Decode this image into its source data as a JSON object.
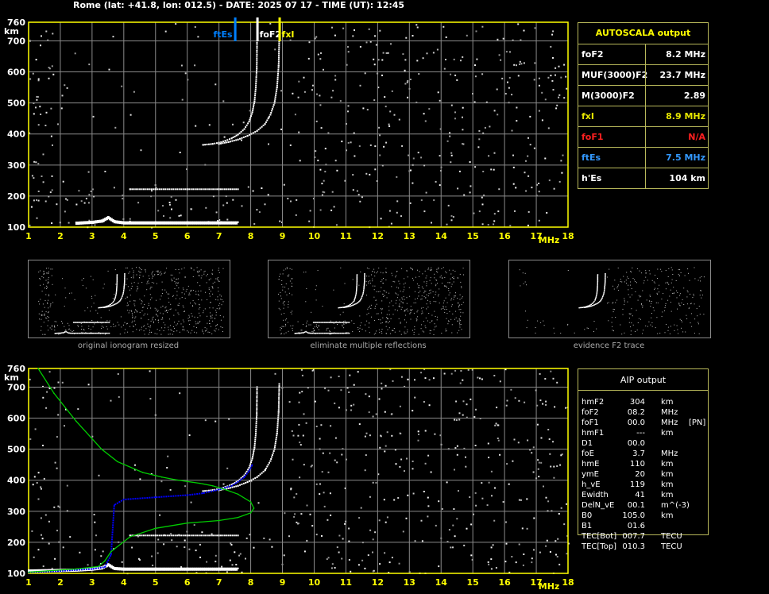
{
  "header": "Rome (lat: +41.8, lon: 012.5) - DATE: 2025 07 17 - TIME (UT): 12:45",
  "colors": {
    "axis": "#ffff00",
    "grid": "#8a8a8a",
    "trace": "#ffffff",
    "fxl": "#ffff00",
    "ftes": "#0080ff",
    "blue_profile": "#0000ff",
    "green_profile": "#00cc00",
    "fof1": "#ff2020"
  },
  "chart_data": [
    {
      "type": "scatter",
      "title": "",
      "xlabel": "MHz",
      "ylabel": "km",
      "xlim": [
        1,
        18
      ],
      "ylim": [
        100,
        760
      ],
      "x_ticks": [
        "1",
        "2",
        "3",
        "4",
        "5",
        "6",
        "7",
        "8",
        "9",
        "10",
        "11",
        "12",
        "13",
        "14",
        "15",
        "16",
        "17",
        "18"
      ],
      "y_ticks": [
        "100",
        "200",
        "300",
        "400",
        "500",
        "600",
        "700",
        "760"
      ],
      "grid": true,
      "markers": [
        {
          "label": "ftEs",
          "x": 7.5,
          "color": "#0080ff"
        },
        {
          "label": "foF2",
          "x": 8.2,
          "color": "#ffffff"
        },
        {
          "label": "fxI",
          "x": 8.9,
          "color": "#ffff00"
        }
      ],
      "series": [
        {
          "trace": "o",
          "x": [
            6.5,
            6.8,
            7.0,
            7.2,
            7.4,
            7.6,
            7.8,
            7.95,
            8.05,
            8.12,
            8.16,
            8.19,
            8.2
          ],
          "y": [
            365,
            368,
            372,
            378,
            386,
            398,
            416,
            440,
            470,
            505,
            550,
            610,
            700
          ]
        },
        {
          "trace": "x",
          "x": [
            7.0,
            7.3,
            7.6,
            7.9,
            8.2,
            8.45,
            8.62,
            8.75,
            8.83,
            8.88,
            8.9
          ],
          "y": [
            368,
            374,
            382,
            394,
            410,
            432,
            462,
            500,
            550,
            620,
            710
          ]
        },
        {
          "trace": "Es",
          "x": [
            2.5,
            3.0,
            3.3,
            3.5,
            3.7,
            4.0,
            5.0,
            6.0,
            7.0,
            7.6
          ],
          "y": [
            115,
            118,
            122,
            133,
            120,
            116,
            116,
            116,
            116,
            116
          ]
        },
        {
          "trace": "E2",
          "x": [
            4.2,
            5.0,
            6.0,
            7.0,
            7.6
          ],
          "y": [
            222,
            222,
            222,
            222,
            222
          ]
        }
      ]
    },
    {
      "type": "scatter",
      "title": "",
      "xlabel": "MHz",
      "ylabel": "km",
      "xlim": [
        1,
        18
      ],
      "ylim": [
        100,
        760
      ],
      "x_ticks": [
        "1",
        "2",
        "3",
        "4",
        "5",
        "6",
        "7",
        "8",
        "9",
        "10",
        "11",
        "12",
        "13",
        "14",
        "15",
        "16",
        "17",
        "18"
      ],
      "y_ticks": [
        "100",
        "200",
        "300",
        "400",
        "500",
        "600",
        "700",
        "760"
      ],
      "grid": true,
      "series": [
        {
          "trace": "o",
          "x": [
            6.5,
            6.8,
            7.0,
            7.2,
            7.4,
            7.6,
            7.8,
            7.95,
            8.05,
            8.12,
            8.16,
            8.19,
            8.2
          ],
          "y": [
            365,
            368,
            372,
            378,
            386,
            398,
            416,
            440,
            470,
            505,
            550,
            610,
            700
          ]
        },
        {
          "trace": "x",
          "x": [
            7.0,
            7.3,
            7.6,
            7.9,
            8.2,
            8.45,
            8.62,
            8.75,
            8.83,
            8.88,
            8.9
          ],
          "y": [
            368,
            374,
            382,
            394,
            410,
            432,
            462,
            500,
            550,
            620,
            710
          ]
        },
        {
          "trace": "Es",
          "x": [
            1.0,
            2.5,
            3.0,
            3.3,
            3.5,
            3.7,
            4.0,
            5.0,
            6.0,
            7.0,
            7.6
          ],
          "y": [
            110,
            113,
            116,
            120,
            130,
            118,
            116,
            116,
            116,
            116,
            116
          ]
        },
        {
          "trace": "E2",
          "x": [
            4.2,
            5.0,
            6.0,
            7.0,
            7.6
          ],
          "y": [
            222,
            222,
            222,
            222,
            222
          ]
        },
        {
          "profile": "blue",
          "x": [
            1.0,
            2.0,
            3.0,
            3.4,
            3.6,
            3.7,
            4.0,
            5.0,
            6.0,
            6.5,
            7.0,
            7.4,
            7.6,
            7.8,
            7.95,
            8.05
          ],
          "y": [
            103,
            108,
            114,
            120,
            160,
            320,
            338,
            345,
            352,
            358,
            370,
            382,
            395,
            410,
            430,
            450
          ]
        },
        {
          "profile": "green",
          "x": [
            1.3,
            1.8,
            2.5,
            3.3,
            3.8,
            4.6,
            5.2,
            5.6,
            6.0,
            6.4,
            6.8,
            7.2,
            7.6,
            8.0,
            8.1,
            8.0,
            7.6,
            7.0,
            6.0,
            5.0,
            4.2,
            3.6,
            3.4,
            3.2,
            2.5,
            1.6,
            1.0
          ],
          "y": [
            760,
            680,
            590,
            500,
            460,
            425,
            410,
            402,
            396,
            390,
            382,
            370,
            355,
            330,
            310,
            295,
            280,
            270,
            262,
            245,
            218,
            170,
            140,
            122,
            114,
            108,
            104
          ]
        }
      ]
    }
  ],
  "autoscala": {
    "title": "AUTOSCALA output",
    "rows": [
      {
        "label": "foF2",
        "value": "8.2 MHz",
        "color": "#ffffff"
      },
      {
        "label": "MUF(3000)F2",
        "value": "23.7 MHz",
        "color": "#ffffff"
      },
      {
        "label": "M(3000)F2",
        "value": "2.89",
        "color": "#ffffff"
      },
      {
        "label": "fxI",
        "value": "8.9 MHz",
        "color": "#e6e600"
      },
      {
        "label": "foF1",
        "value": "N/A",
        "color": "#ff2020"
      },
      {
        "label": "ftEs",
        "value": "7.5 MHz",
        "color": "#3399ff"
      },
      {
        "label": "h'Es",
        "value": "104   km",
        "color": "#ffffff"
      }
    ]
  },
  "thumbnails": [
    {
      "caption": "original ionogram resized"
    },
    {
      "caption": "eliminate multiple reflections"
    },
    {
      "caption": "evidence F2 trace"
    }
  ],
  "aip": {
    "title": "AIP output",
    "rows": [
      {
        "name": "hmF2",
        "value": "304",
        "unit": "km",
        "extra": ""
      },
      {
        "name": "foF2",
        "value": "08.2",
        "unit": "MHz",
        "extra": ""
      },
      {
        "name": "foF1",
        "value": "00.0",
        "unit": "MHz",
        "extra": "[PN]"
      },
      {
        "name": "hmF1",
        "value": "---",
        "unit": "km",
        "extra": ""
      },
      {
        "name": "D1",
        "value": "00.0",
        "unit": "",
        "extra": ""
      },
      {
        "name": "foE",
        "value": "3.7",
        "unit": "MHz",
        "extra": ""
      },
      {
        "name": "hmE",
        "value": "110",
        "unit": "km",
        "extra": ""
      },
      {
        "name": "ymE",
        "value": "20",
        "unit": "km",
        "extra": ""
      },
      {
        "name": "h_vE",
        "value": "119",
        "unit": "km",
        "extra": ""
      },
      {
        "name": "Ewidth",
        "value": "41",
        "unit": "km",
        "extra": ""
      },
      {
        "name": "DelN_vE",
        "value": "00.1",
        "unit": "m^(-3)",
        "extra": ""
      },
      {
        "name": "B0",
        "value": "105.0",
        "unit": "km",
        "extra": ""
      },
      {
        "name": "B1",
        "value": "01.6",
        "unit": "",
        "extra": ""
      },
      {
        "name": "TEC[Bot]",
        "value": "007.7",
        "unit": "TECU",
        "extra": ""
      },
      {
        "name": "TEC[Top]",
        "value": "010.3",
        "unit": "TECU",
        "extra": ""
      }
    ]
  }
}
